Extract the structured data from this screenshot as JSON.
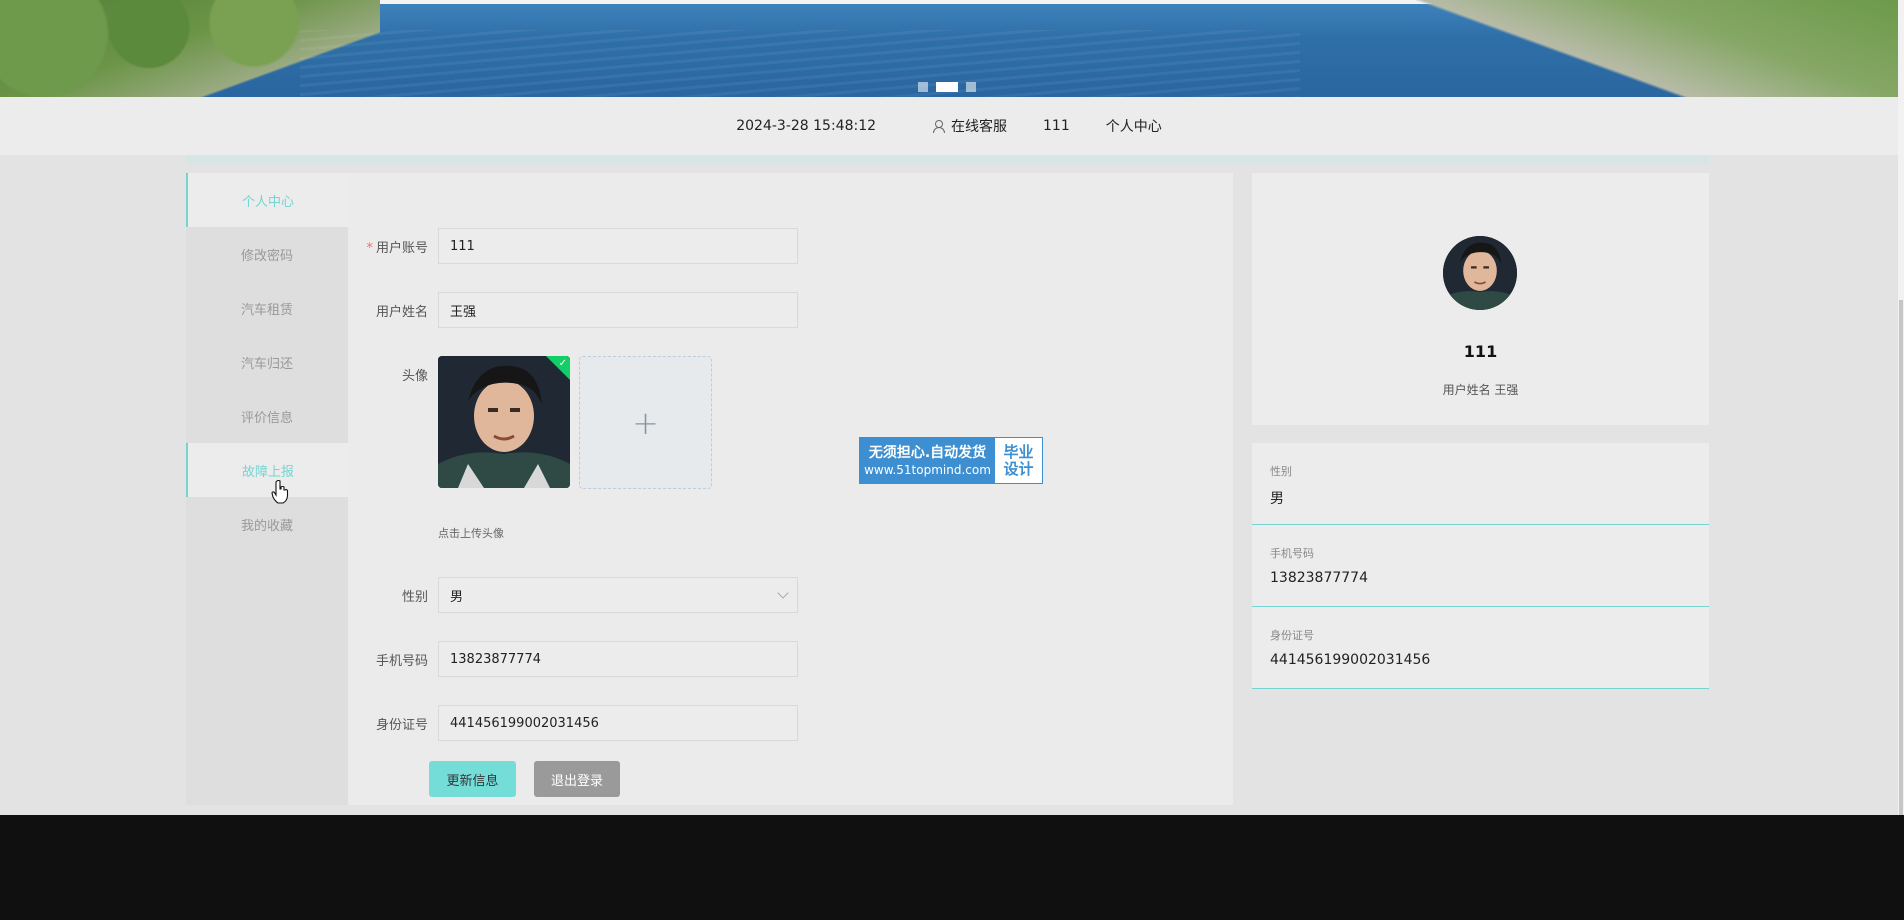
{
  "banner": {
    "slides": 3,
    "active_slide": 2
  },
  "topnav": {
    "datetime": "2024-3-28 15:48:12",
    "service": "在线客服",
    "username": "111",
    "personal_center": "个人中心"
  },
  "sidebar": {
    "items": [
      {
        "label": "个人中心"
      },
      {
        "label": "修改密码"
      },
      {
        "label": "汽车租赁"
      },
      {
        "label": "汽车归还"
      },
      {
        "label": "评价信息"
      },
      {
        "label": "故障上报"
      },
      {
        "label": "我的收藏"
      }
    ]
  },
  "form": {
    "account_label": "用户账号",
    "account_value": "111",
    "name_label": "用户姓名",
    "name_value": "王强",
    "avatar_label": "头像",
    "upload_plus": "+",
    "upload_tip": "点击上传头像",
    "gender_label": "性别",
    "gender_value": "男",
    "phone_label": "手机号码",
    "phone_value": "13823877774",
    "id_label": "身份证号",
    "id_value": "441456199002031456",
    "update_button": "更新信息",
    "logout_button": "退出登录"
  },
  "watermark": {
    "line1": "无须担心.自动发货",
    "line2": "www.51topmind.com",
    "right1": "毕业",
    "right2": "设计"
  },
  "profile": {
    "username": "111",
    "subtitle": "用户姓名 王强",
    "fields": [
      {
        "label": "性别",
        "value": "男"
      },
      {
        "label": "手机号码",
        "value": "13823877774"
      },
      {
        "label": "身份证号",
        "value": "441456199002031456"
      }
    ]
  },
  "colors": {
    "accent": "#75d4d0",
    "button_update": "#75ddd8",
    "button_logout": "#9a9a9a",
    "required": "#f56c6c"
  }
}
